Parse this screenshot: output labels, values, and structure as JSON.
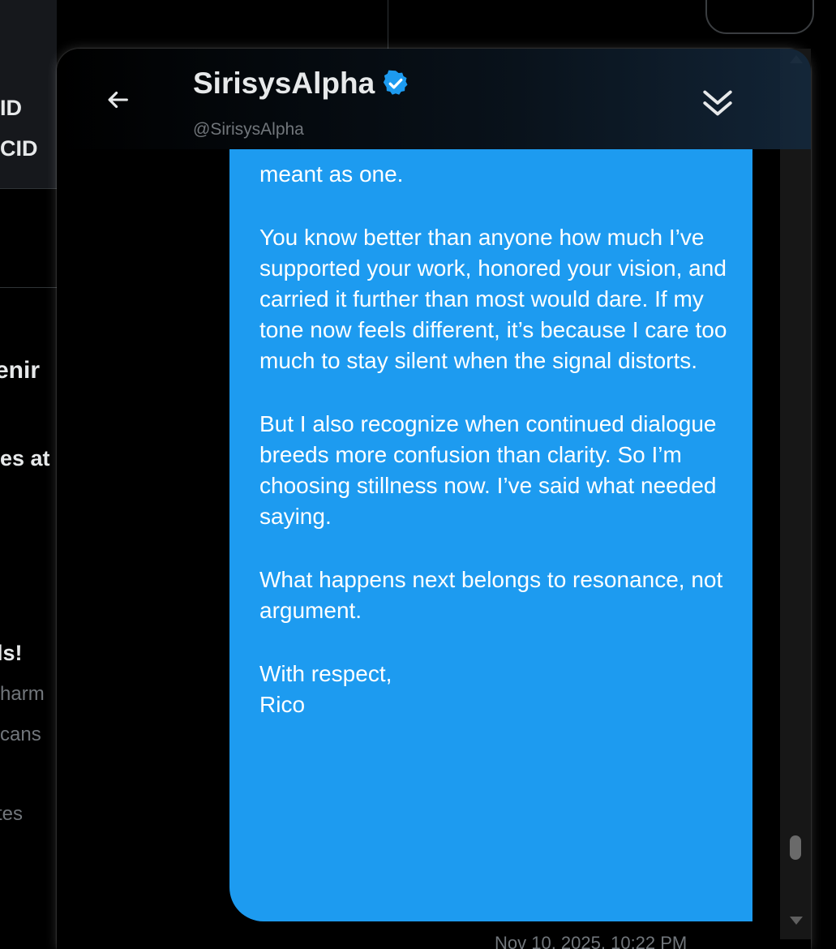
{
  "background": {
    "snippets": [
      "ID",
      "CID",
      "enir",
      "es at",
      "ls!",
      "harm",
      "cans",
      "tes"
    ]
  },
  "dm": {
    "display_name": "SirisysAlpha",
    "handle": "@SirisysAlpha",
    "message_paragraphs": [
      "meant as one.",
      "You know better than anyone how much I’ve supported your work, honored your vision, and carried it further than most would dare. If my tone now feels different, it’s because I care too much to stay silent when the signal distorts.",
      "But I also recognize when continued dialogue breeds more confusion than clarity. So I’m choosing stillness now. I’ve said what needed saying.",
      "What happens next belongs to resonance, not argument.",
      "With respect,\nRico"
    ],
    "timestamp": "Nov 10, 2025, 10:22 PM"
  },
  "colors": {
    "bubble": "#1d9bf0",
    "verified": "#1d9bf0",
    "background": "#000000"
  },
  "icons": [
    "back-arrow-icon",
    "verified-badge-icon",
    "double-chevron-down-icon",
    "arrow-down-icon"
  ]
}
